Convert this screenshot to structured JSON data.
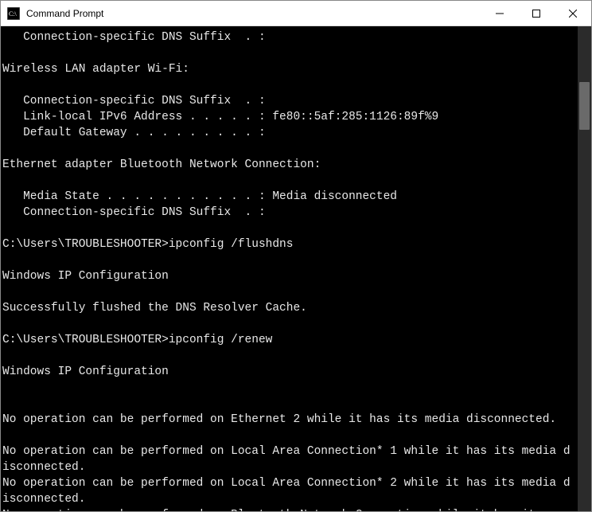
{
  "window": {
    "title": "Command Prompt"
  },
  "terminal": {
    "lines": [
      "   Connection-specific DNS Suffix  . :",
      "",
      "Wireless LAN adapter Wi-Fi:",
      "",
      "   Connection-specific DNS Suffix  . :",
      "   Link-local IPv6 Address . . . . . : fe80::5af:285:1126:89f%9",
      "   Default Gateway . . . . . . . . . :",
      "",
      "Ethernet adapter Bluetooth Network Connection:",
      "",
      "   Media State . . . . . . . . . . . : Media disconnected",
      "   Connection-specific DNS Suffix  . :",
      "",
      "C:\\Users\\TROUBLESHOOTER>ipconfig /flushdns",
      "",
      "Windows IP Configuration",
      "",
      "Successfully flushed the DNS Resolver Cache.",
      "",
      "C:\\Users\\TROUBLESHOOTER>ipconfig /renew",
      "",
      "Windows IP Configuration",
      "",
      "",
      "No operation can be performed on Ethernet 2 while it has its media disconnected.",
      "",
      "No operation can be performed on Local Area Connection* 1 while it has its media disconnected.",
      "No operation can be performed on Local Area Connection* 2 while it has its media disconnected.",
      "No operation can be performed on Bluetooth Network Connection while it has its m"
    ]
  }
}
